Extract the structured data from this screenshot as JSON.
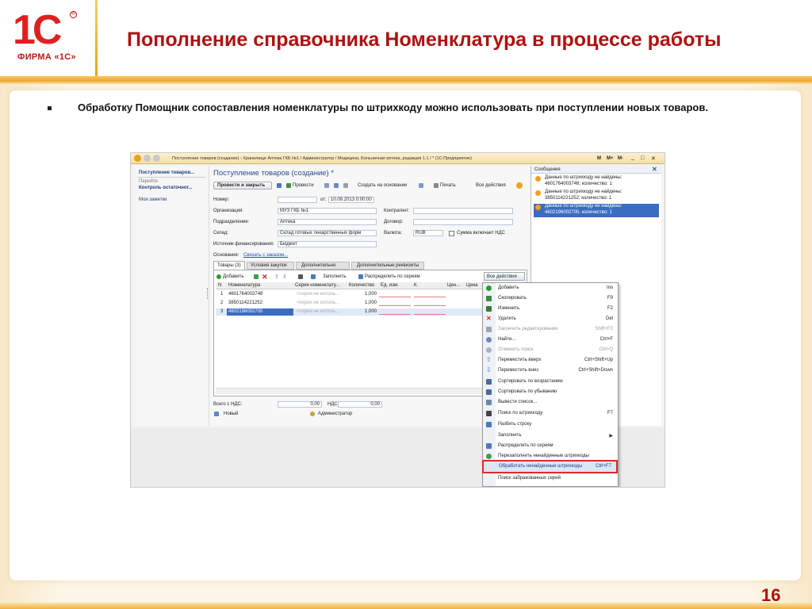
{
  "slide": {
    "logo_text": "1С",
    "logo_registered": "®",
    "logo_firm": "ФИРМА «1С»",
    "title": "Пополнение справочника Номенклатура в процессе работы",
    "bullet": "Обработку Помощник сопоставления номенклатуры по штрихкоду можно использовать при поступлении новых товаров.",
    "page_number": "16"
  },
  "window": {
    "title": "Поступление товаров (создание) - Хранилище Аптека ГКБ №1 / Администратор / Медицина. Больничная аптека, редакция 1.1 / * (1С:Предприятие)",
    "controls": [
      "M",
      "M+",
      "M-",
      "_",
      "□",
      "✕"
    ]
  },
  "left_nav": {
    "active": "Поступление товаров...",
    "goto_label": "Перейти",
    "items": [
      "Контроль остаточног...",
      "Мои заметки"
    ]
  },
  "form": {
    "header": "Поступление товаров (создание) *",
    "toolbar": {
      "post_close": "Провести и закрыть",
      "post": "Провести",
      "create_based": "Создать на основании",
      "print": "Печать",
      "all_actions": "Все действия"
    },
    "fields": {
      "number_label": "Номер:",
      "number_value": "",
      "date_from": "от:",
      "date_value": "10.09.2013  0:00:00",
      "org_label": "Организация:",
      "org_value": "МУЗ ГКБ №1",
      "contractor_label": "Контрагент:",
      "contractor_value": "",
      "dept_label": "Подразделение:",
      "dept_value": "Аптека",
      "contract_label": "Договор:",
      "contract_value": "",
      "warehouse_label": "Склад:",
      "warehouse_value": "Склад готовых лекарственных форм",
      "currency_label": "Валюта:",
      "currency_value": "RUB",
      "vat_includes": "Сумма включает НДС",
      "fin_source_label": "Источник финансирования:",
      "fin_source_value": "Бюджет",
      "basis_label": "Основание:",
      "basis_link": "Связать с заказом..."
    },
    "tabs": [
      "Товары (3)",
      "Условия закупок",
      "Дополнительно",
      "Дополнительные реквизиты"
    ],
    "table_toolbar": {
      "add": "Добавить",
      "fill": "Заполнить",
      "distribute": "Распределить по сериям",
      "all_actions": "Все действия"
    },
    "columns": [
      "N",
      "Номенклатура",
      "Серия номенклату...",
      "Количество",
      "Ед. изм.",
      "К.",
      "Цен...",
      "Цена"
    ],
    "rows": [
      {
        "n": "1",
        "code": "4601764003748",
        "series": "<серии не исполь...",
        "qty": "1,000"
      },
      {
        "n": "2",
        "code": "3850114221252",
        "series": "<серии не исполь...",
        "qty": "1,000"
      },
      {
        "n": "3",
        "code": "4602196002705",
        "series": "<серии не исполь...",
        "qty": "1,000"
      }
    ],
    "totals": {
      "total_vat_label": "Всего с НДС:",
      "total_vat_value": "0,00",
      "vat_label": "НДС:",
      "vat_value": "0,00"
    },
    "status": {
      "state": "Новый",
      "user": "Администратор"
    }
  },
  "messages": {
    "title": "Сообщения",
    "items": [
      {
        "line1": "Данные по штрихкоду не найдены:",
        "line2": "4601764003748; количество: 1"
      },
      {
        "line1": "Данные по штрихкоду не найдены:",
        "line2": "3850114221252; количество: 1"
      },
      {
        "line1": "Данные по штрихкоду не найдены:",
        "line2": "4602196002705; количество: 1"
      }
    ]
  },
  "context_menu": [
    {
      "label": "Добавить",
      "shortcut": "Ins",
      "icon_color": "#2e9a2e",
      "disabled": false
    },
    {
      "label": "Скопировать",
      "shortcut": "F9",
      "icon_color": "#3a8a3a",
      "disabled": false
    },
    {
      "label": "Изменить",
      "shortcut": "F2",
      "icon_color": "#3a7a2a",
      "disabled": false
    },
    {
      "label": "Удалить",
      "shortcut": "Del",
      "icon_color": "#d02a2a",
      "disabled": false
    },
    {
      "label": "Закончить редактирование",
      "shortcut": "Shift+F2",
      "icon_color": "#9aa4b4",
      "disabled": true
    },
    {
      "label": "Найти...",
      "shortcut": "Ctrl+F",
      "icon_color": "#6a8ab8",
      "disabled": false
    },
    {
      "label": "Отменить поиск",
      "shortcut": "Ctrl+Q",
      "icon_color": "#aab4c4",
      "disabled": true
    },
    {
      "label": "Переместить вверх",
      "shortcut": "Ctrl+Shift+Up",
      "icon_color": "#3a78c8",
      "disabled": false
    },
    {
      "label": "Переместить вниз",
      "shortcut": "Ctrl+Shift+Down",
      "icon_color": "#3a78c8",
      "disabled": false
    },
    {
      "label": "Сортировать по возрастанию",
      "shortcut": "",
      "icon_color": "#4a6a9a",
      "disabled": false
    },
    {
      "label": "Сортировать по убыванию",
      "shortcut": "",
      "icon_color": "#4a6a9a",
      "disabled": false
    },
    {
      "label": "Вывести список...",
      "shortcut": "",
      "icon_color": "#6a88a8",
      "disabled": false
    },
    {
      "label": "Поиск по штрихкоду",
      "shortcut": "F7",
      "icon_color": "#444444",
      "disabled": false
    },
    {
      "label": "Разбить строку",
      "shortcut": "",
      "icon_color": "#4a7ab8",
      "disabled": false
    },
    {
      "label": "Заполнить",
      "shortcut": "▶",
      "icon_color": "",
      "disabled": false
    },
    {
      "label": "Распределить по сериям",
      "shortcut": "",
      "icon_color": "#4a7ab8",
      "disabled": false
    },
    {
      "label": "Перезаполнить ненайденные штрихкоды",
      "shortcut": "",
      "icon_color": "#4a9a4a",
      "disabled": false
    },
    {
      "label": "Обработать ненайденные штрихкоды",
      "shortcut": "Ctrl+F7",
      "icon_color": "",
      "disabled": false,
      "highlighted": true
    },
    {
      "label": "Поиск забракованных серий",
      "shortcut": "",
      "icon_color": "",
      "disabled": false
    }
  ]
}
